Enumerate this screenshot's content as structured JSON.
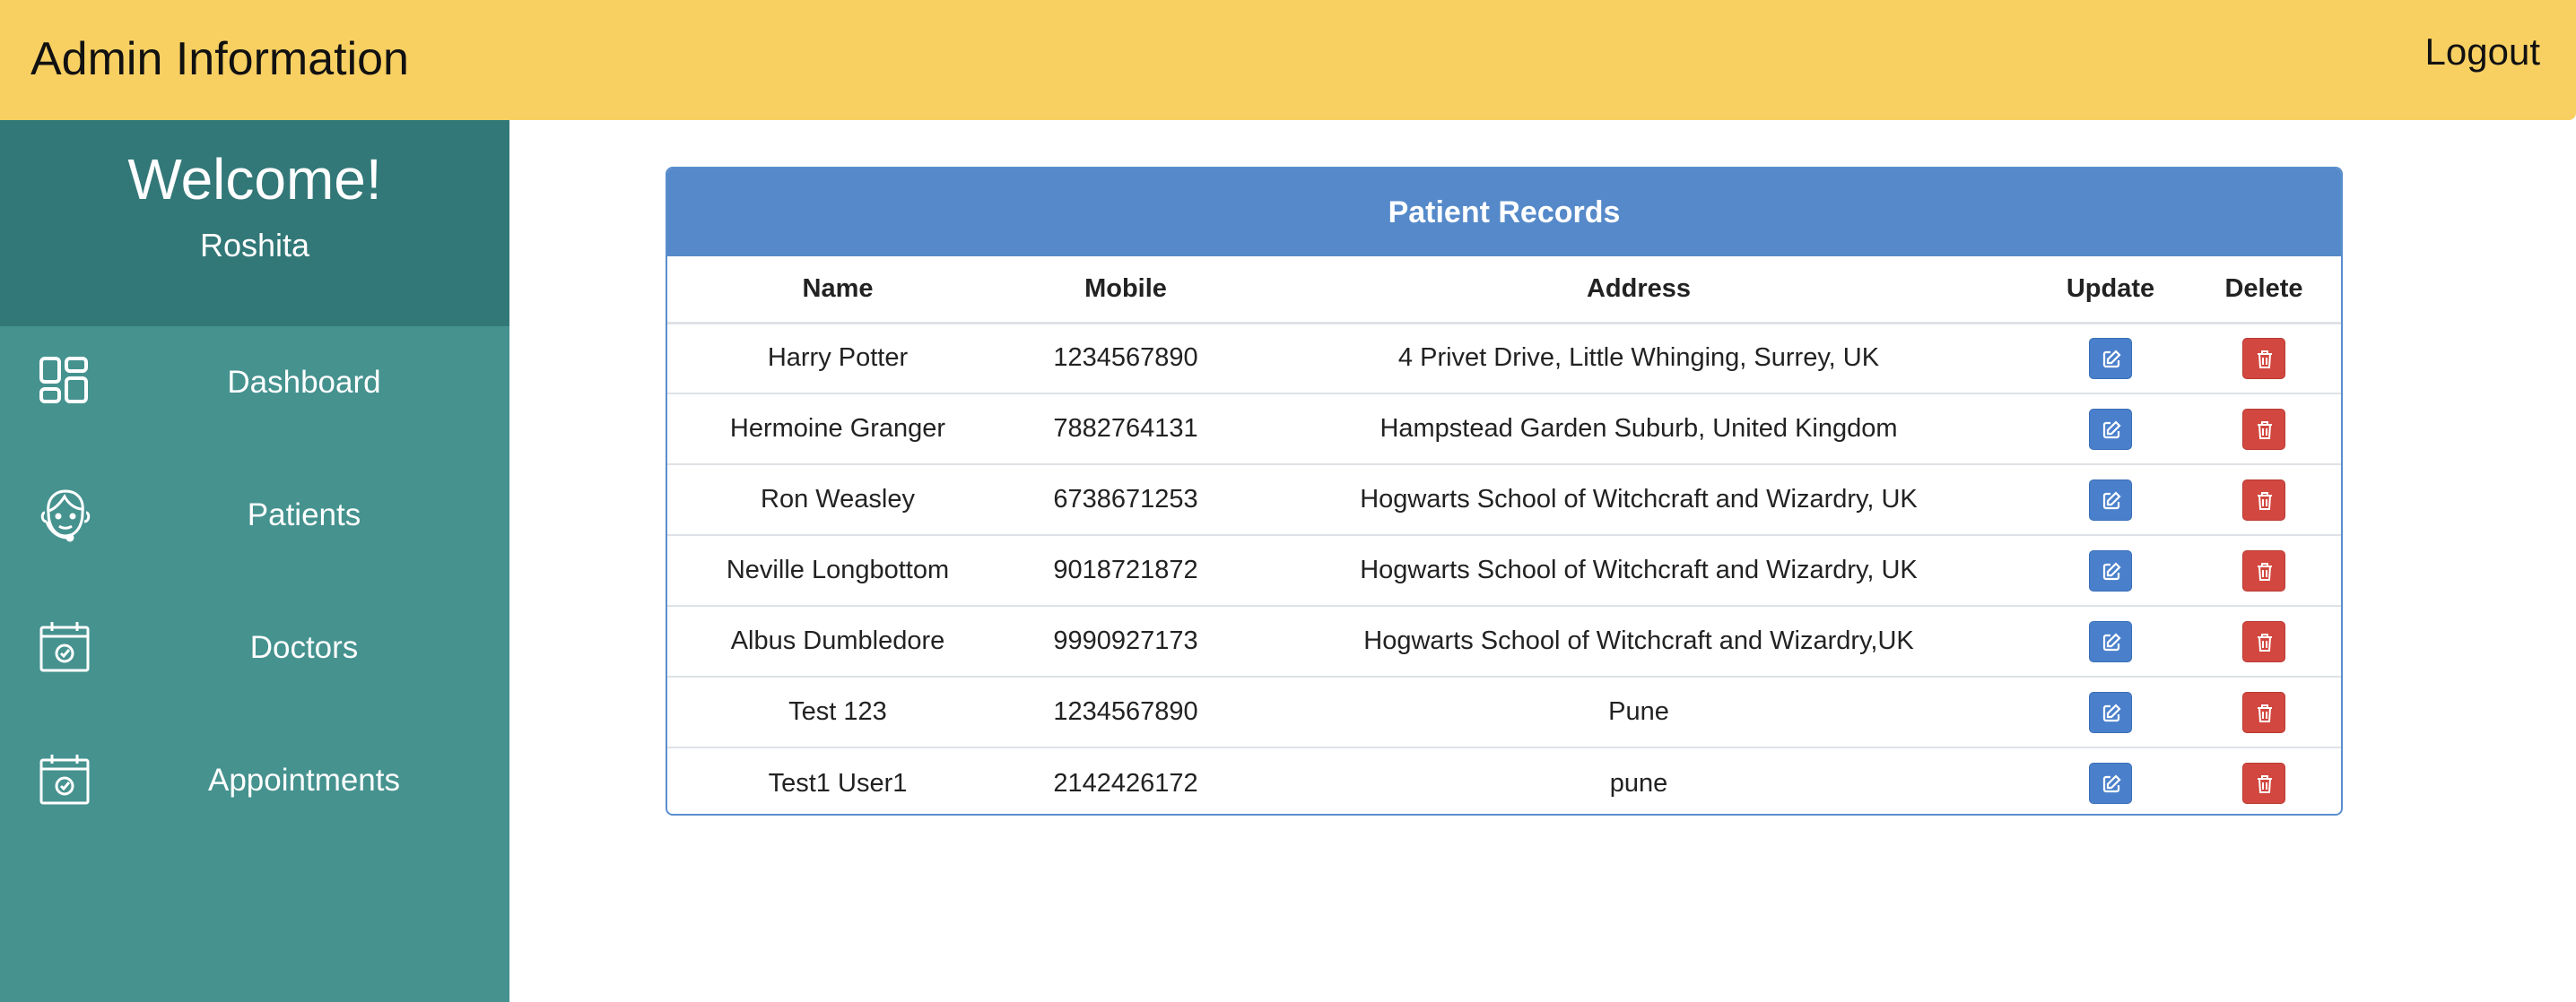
{
  "header": {
    "title": "Admin Information",
    "logout_label": "Logout"
  },
  "sidebar": {
    "welcome": "Welcome!",
    "username": "Roshita",
    "items": [
      {
        "label": "Dashboard",
        "icon": "dashboard-grid-icon"
      },
      {
        "label": "Patients",
        "icon": "patient-face-icon"
      },
      {
        "label": "Doctors",
        "icon": "calendar-check-icon"
      },
      {
        "label": "Appointments",
        "icon": "calendar-check-icon"
      }
    ]
  },
  "colors": {
    "topbar": "#f8d062",
    "sidebar": "#45928f",
    "welcome_block": "#337878",
    "card_header": "#5589c9",
    "update_button": "#4a80cb",
    "delete_button": "#d2473f"
  },
  "table": {
    "title": "Patient Records",
    "columns": [
      "Name",
      "Mobile",
      "Address",
      "Update",
      "Delete"
    ],
    "rows": [
      {
        "name": "Harry Potter",
        "mobile": "1234567890",
        "address": "4 Privet Drive, Little Whinging, Surrey, UK"
      },
      {
        "name": "Hermoine Granger",
        "mobile": "7882764131",
        "address": "Hampstead Garden Suburb, United Kingdom"
      },
      {
        "name": "Ron Weasley",
        "mobile": "6738671253",
        "address": "Hogwarts School of Witchcraft and Wizardry, UK"
      },
      {
        "name": "Neville Longbottom",
        "mobile": "9018721872",
        "address": "Hogwarts School of Witchcraft and Wizardry, UK"
      },
      {
        "name": "Albus Dumbledore",
        "mobile": "9990927173",
        "address": "Hogwarts School of Witchcraft and Wizardry,UK"
      },
      {
        "name": "Test 123",
        "mobile": "1234567890",
        "address": "Pune"
      },
      {
        "name": "Test1 User1",
        "mobile": "2142426172",
        "address": "pune"
      }
    ]
  }
}
